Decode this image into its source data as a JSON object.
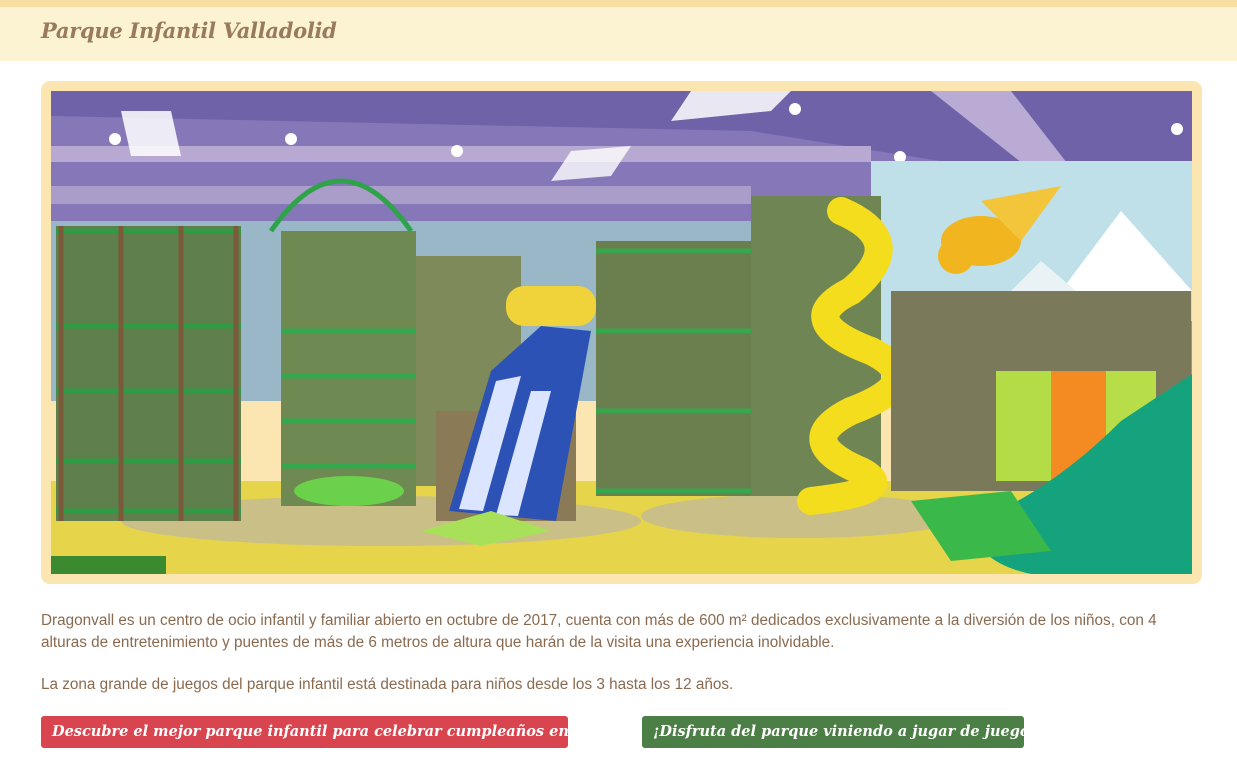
{
  "header": {
    "title": "Parque Infantil Valladolid"
  },
  "hero_image": {
    "alt": "Dragonvall indoor playground"
  },
  "content": {
    "paragraph_1": "Dragonvall es un centro de ocio infantil y familiar abierto en octubre de 2017, cuenta con más de 600 m² dedicados exclusivamente a la diversión de los niños, con 4 alturas de entretenimiento y puentes de más de 6 metros de altura que harán de la visita una experiencia inolvidable.",
    "paragraph_2": "La zona grande de juegos del parque infantil está destinada para niños desde los 3 hasta los 12 años."
  },
  "buttons": {
    "birthday_label": "Descubre el mejor parque infantil para celebrar cumpleaños en Valladolid",
    "birthday_icon": "🎂",
    "free_play_label": "¡Disfruta del parque viniendo a jugar de juego libre!",
    "free_play_icon": "🯅"
  },
  "colors": {
    "header_bg": "#fbf3d2",
    "frame": "#fbe5b0",
    "text": "#8a6a4f",
    "btn_red": "#d9454f",
    "btn_green": "#4b7f45"
  }
}
